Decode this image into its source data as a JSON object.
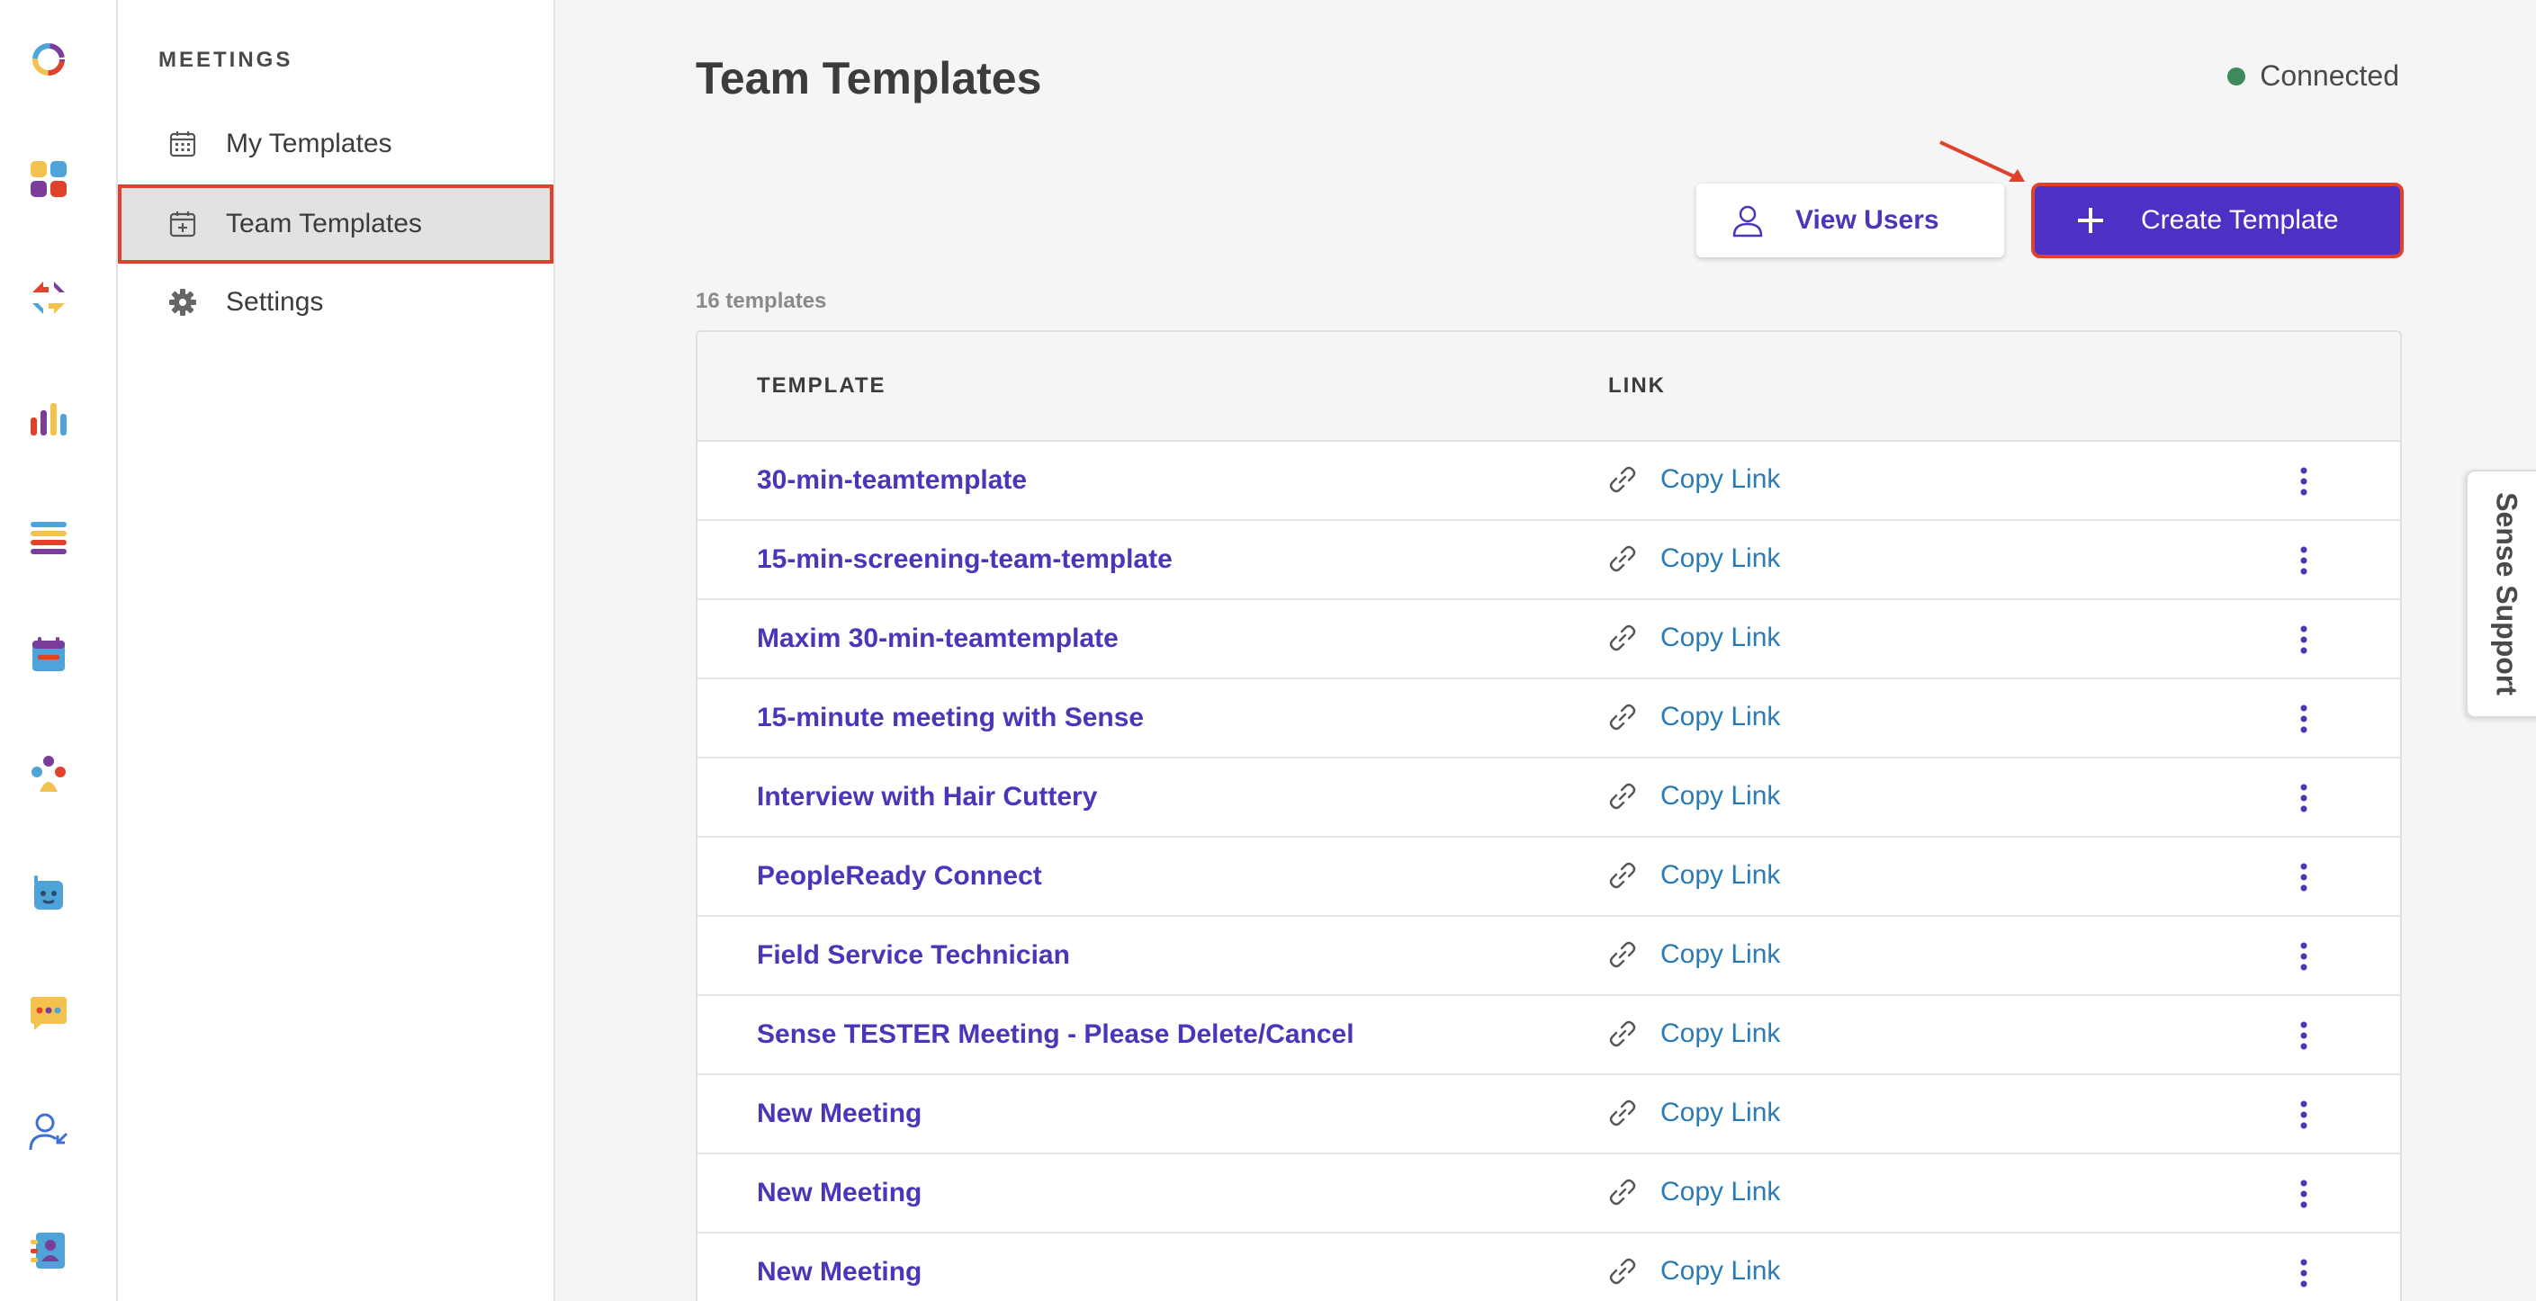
{
  "rail": {
    "icons": [
      "logo-ring-icon",
      "apps-grid-icon",
      "arrows-icon",
      "analytics-icon",
      "list-icon",
      "calendar-icon",
      "team-icon",
      "bot-icon",
      "chat-icon",
      "user-arrow-icon",
      "contacts-icon"
    ]
  },
  "sidebar": {
    "heading": "MEETINGS",
    "items": [
      {
        "label": "My Templates",
        "icon": "calendar-icon"
      },
      {
        "label": "Team Templates",
        "icon": "calendar-plus-icon",
        "active": true
      },
      {
        "label": "Settings",
        "icon": "gear-icon"
      }
    ]
  },
  "header": {
    "title": "Team Templates",
    "status": "Connected",
    "status_color": "#3d8a5a"
  },
  "actions": {
    "view_users": "View Users",
    "create_template": "Create Template",
    "accent": "#4e30c4",
    "highlight": "#e0412a"
  },
  "table": {
    "count_label": "16 templates",
    "columns": [
      "TEMPLATE",
      "LINK"
    ],
    "copy_label": "Copy Link",
    "rows": [
      "30-min-teamtemplate",
      "15-min-screening-team-template",
      "Maxim 30-min-teamtemplate",
      "15-minute meeting with Sense",
      "Interview with Hair Cuttery",
      "PeopleReady Connect",
      "Field Service Technician",
      "Sense TESTER Meeting - Please Delete/Cancel",
      "New Meeting",
      "New Meeting",
      "New Meeting"
    ]
  },
  "support": {
    "label": "Sense Support"
  }
}
